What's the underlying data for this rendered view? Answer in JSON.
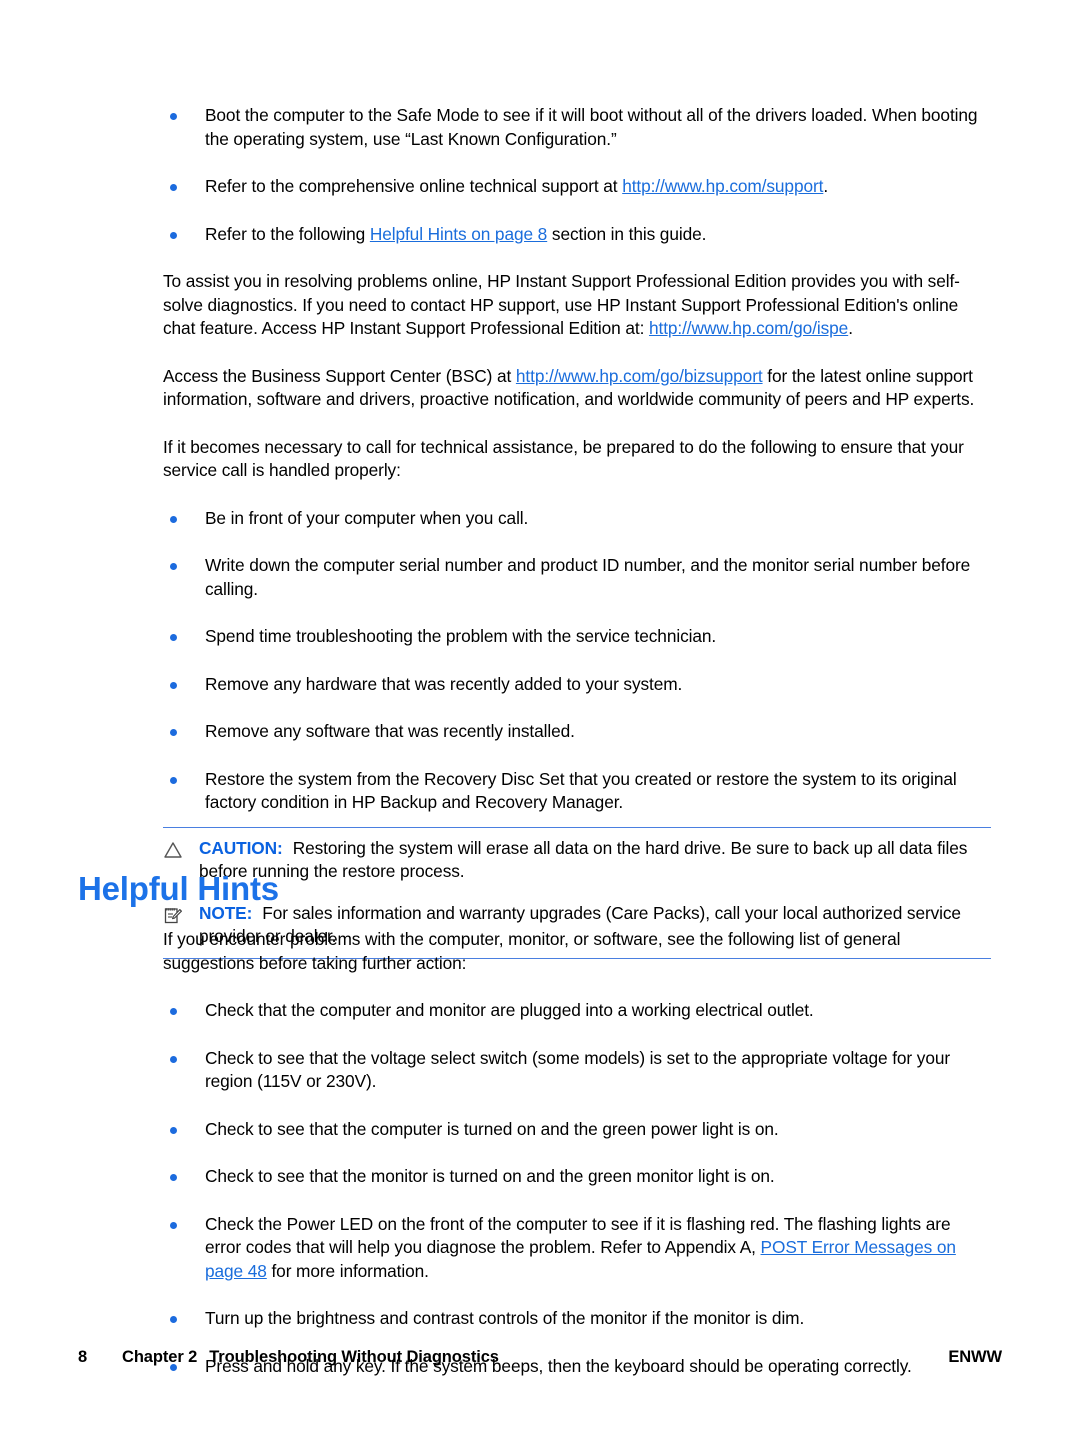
{
  "document": {
    "top_bullets": [
      {
        "parts": [
          {
            "type": "text",
            "value": "Boot the computer to the Safe Mode to see if it will boot without all of the drivers loaded. When booting the operating system, use “Last Known Configuration.”"
          }
        ]
      },
      {
        "parts": [
          {
            "type": "text",
            "value": "Refer to the comprehensive online technical support at "
          },
          {
            "type": "link",
            "value": "http://www.hp.com/support"
          },
          {
            "type": "text",
            "value": "."
          }
        ]
      },
      {
        "parts": [
          {
            "type": "text",
            "value": "Refer to the following "
          },
          {
            "type": "link",
            "value": "Helpful Hints on page 8"
          },
          {
            "type": "text",
            "value": " section in this guide."
          }
        ]
      }
    ],
    "paragraph_ispe": {
      "parts": [
        {
          "type": "text",
          "value": "To assist you in resolving problems online, HP Instant Support Professional Edition provides you with self-solve diagnostics. If you need to contact HP support, use HP Instant Support Professional Edition's online chat feature. Access HP Instant Support Professional Edition at: "
        },
        {
          "type": "link",
          "value": "http://www.hp.com/go/ispe"
        },
        {
          "type": "text",
          "value": "."
        }
      ]
    },
    "paragraph_bsc": {
      "parts": [
        {
          "type": "text",
          "value": "Access the Business Support Center (BSC) at "
        },
        {
          "type": "link",
          "value": "http://www.hp.com/go/bizsupport"
        },
        {
          "type": "text",
          "value": " for the latest online support information, software and drivers, proactive notification, and worldwide community of peers and HP experts."
        }
      ]
    },
    "paragraph_service_call": {
      "parts": [
        {
          "type": "text",
          "value": "If it becomes necessary to call for technical assistance, be prepared to do the following to ensure that your service call is handled properly:"
        }
      ]
    },
    "service_bullets": [
      {
        "parts": [
          {
            "type": "text",
            "value": "Be in front of your computer when you call."
          }
        ]
      },
      {
        "parts": [
          {
            "type": "text",
            "value": "Write down the computer serial number and product ID number, and the monitor serial number before calling."
          }
        ]
      },
      {
        "parts": [
          {
            "type": "text",
            "value": "Spend time troubleshooting the problem with the service technician."
          }
        ]
      },
      {
        "parts": [
          {
            "type": "text",
            "value": "Remove any hardware that was recently added to your system."
          }
        ]
      },
      {
        "parts": [
          {
            "type": "text",
            "value": "Remove any software that was recently installed."
          }
        ]
      },
      {
        "parts": [
          {
            "type": "text",
            "value": "Restore the system from the Recovery Disc Set that you created or restore the system to its original factory condition in HP Backup and Recovery Manager."
          }
        ]
      }
    ],
    "caution": {
      "icon": "warning-triangle-icon",
      "label": "CAUTION:",
      "text": "Restoring the system will erase all data on the hard drive. Be sure to back up all data files before running the restore process."
    },
    "note": {
      "icon": "note-pencil-icon",
      "label": "NOTE:",
      "text": "For sales information and warranty upgrades (Care Packs), call your local authorized service provider or dealer."
    },
    "section_title": "Helpful Hints",
    "paragraph_helpful_intro": {
      "parts": [
        {
          "type": "text",
          "value": "If you encounter problems with the computer, monitor, or software, see the following list of general suggestions before taking further action:"
        }
      ]
    },
    "helpful_bullets": [
      {
        "parts": [
          {
            "type": "text",
            "value": "Check that the computer and monitor are plugged into a working electrical outlet."
          }
        ]
      },
      {
        "parts": [
          {
            "type": "text",
            "value": "Check to see that the voltage select switch (some models) is set to the appropriate voltage for your region (115V or 230V)."
          }
        ]
      },
      {
        "parts": [
          {
            "type": "text",
            "value": "Check to see that the computer is turned on and the green power light is on."
          }
        ]
      },
      {
        "parts": [
          {
            "type": "text",
            "value": "Check to see that the monitor is turned on and the green monitor light is on."
          }
        ]
      },
      {
        "parts": [
          {
            "type": "text",
            "value": "Check the Power LED on the front of the computer to see if it is flashing red. The flashing lights are error codes that will help you diagnose the problem. Refer to Appendix A, "
          },
          {
            "type": "link",
            "value": "POST Error Messages on page 48"
          },
          {
            "type": "text",
            "value": " for more information."
          }
        ]
      },
      {
        "parts": [
          {
            "type": "text",
            "value": "Turn up the brightness and contrast controls of the monitor if the monitor is dim."
          }
        ]
      },
      {
        "parts": [
          {
            "type": "text",
            "value": "Press and hold any key. If the system beeps, then the keyboard should be operating correctly."
          }
        ]
      }
    ],
    "footer": {
      "page_number": "8",
      "chapter": "Chapter 2",
      "chapter_title": "Troubleshooting Without Diagnostics",
      "locale": "ENWW"
    },
    "colors": {
      "link": "#1a6ddc",
      "bullet": "#1c6bde",
      "heading": "#1c72e8",
      "admon_label": "#0b62e0",
      "admon_rule": "#4a7fe0",
      "text": "#000000"
    }
  }
}
